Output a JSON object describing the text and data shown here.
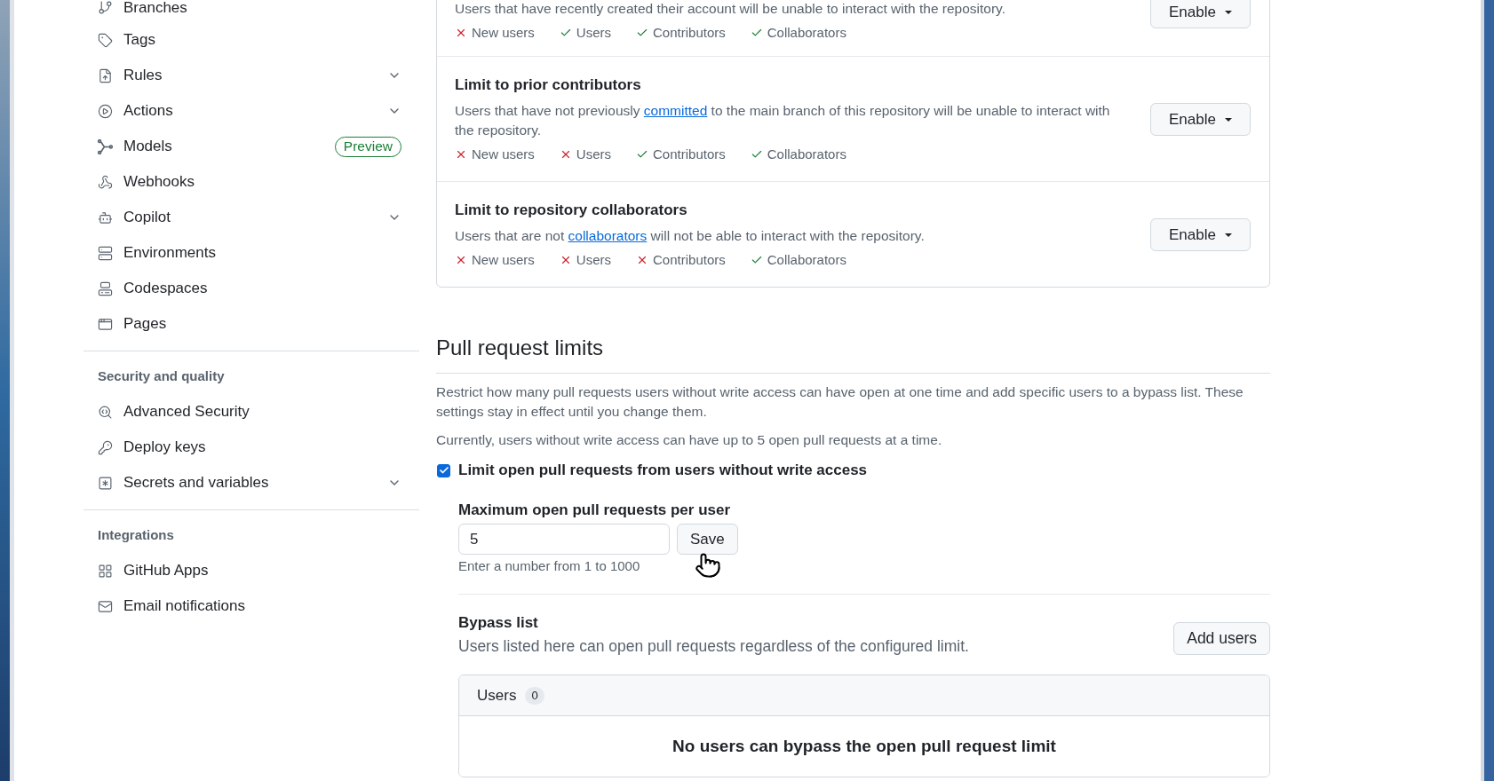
{
  "sidebar": {
    "groups": [
      {
        "items": [
          {
            "label": "Branches",
            "expandable": false
          },
          {
            "label": "Tags",
            "expandable": false
          },
          {
            "label": "Rules",
            "expandable": true
          },
          {
            "label": "Actions",
            "expandable": true
          },
          {
            "label": "Models",
            "expandable": false,
            "badge": "Preview"
          },
          {
            "label": "Webhooks",
            "expandable": false
          },
          {
            "label": "Copilot",
            "expandable": true
          },
          {
            "label": "Environments",
            "expandable": false
          },
          {
            "label": "Codespaces",
            "expandable": false
          },
          {
            "label": "Pages",
            "expandable": false
          }
        ]
      },
      {
        "heading": "Security and quality",
        "items": [
          {
            "label": "Advanced Security",
            "expandable": false
          },
          {
            "label": "Deploy keys",
            "expandable": false
          },
          {
            "label": "Secrets and variables",
            "expandable": true
          }
        ]
      },
      {
        "heading": "Integrations",
        "items": [
          {
            "label": "GitHub Apps",
            "expandable": false
          },
          {
            "label": "Email notifications",
            "expandable": false
          }
        ]
      }
    ]
  },
  "interaction_limits": {
    "rows": [
      {
        "description": [
          {
            "kind": "text",
            "text": "Users that have recently created their account will be unable to interact with the repository."
          }
        ],
        "permissions": [
          {
            "label": "New users",
            "allowed": false
          },
          {
            "label": "Users",
            "allowed": true
          },
          {
            "label": "Contributors",
            "allowed": true
          },
          {
            "label": "Collaborators",
            "allowed": true
          }
        ],
        "button": "Enable"
      },
      {
        "title": "Limit to prior contributors",
        "description": [
          {
            "kind": "text",
            "text": "Users that have not previously "
          },
          {
            "kind": "link",
            "text": "committed"
          },
          {
            "kind": "text",
            "text": " to the main branch of this repository will be unable to interact with the repository."
          }
        ],
        "permissions": [
          {
            "label": "New users",
            "allowed": false
          },
          {
            "label": "Users",
            "allowed": false
          },
          {
            "label": "Contributors",
            "allowed": true
          },
          {
            "label": "Collaborators",
            "allowed": true
          }
        ],
        "button": "Enable"
      },
      {
        "title": "Limit to repository collaborators",
        "description": [
          {
            "kind": "text",
            "text": "Users that are not "
          },
          {
            "kind": "link",
            "text": "collaborators"
          },
          {
            "kind": "text",
            "text": " will not be able to interact with the repository."
          }
        ],
        "permissions": [
          {
            "label": "New users",
            "allowed": false
          },
          {
            "label": "Users",
            "allowed": false
          },
          {
            "label": "Contributors",
            "allowed": false
          },
          {
            "label": "Collaborators",
            "allowed": true
          }
        ],
        "button": "Enable"
      }
    ]
  },
  "pull_request_limits": {
    "heading": "Pull request limits",
    "description": "Restrict how many pull requests users without write access can have open at one time and add specific users to a bypass list. These settings stay in effect until you change them.",
    "current": "Currently, users without write access can have up to 5 open pull requests at a time.",
    "limit_checkbox": {
      "label": "Limit open pull requests from users without write access",
      "checked": true
    },
    "max_field": {
      "label": "Maximum open pull requests per user",
      "value": "5",
      "button": "Save",
      "hint": "Enter a number from 1 to 1000"
    },
    "bypass": {
      "title": "Bypass list",
      "description": "Users listed here can open pull requests regardless of the configured limit.",
      "button": "Add users",
      "list_header": {
        "label": "Users",
        "count": "0"
      },
      "empty_message": "No users can bypass the open pull request limit"
    }
  }
}
